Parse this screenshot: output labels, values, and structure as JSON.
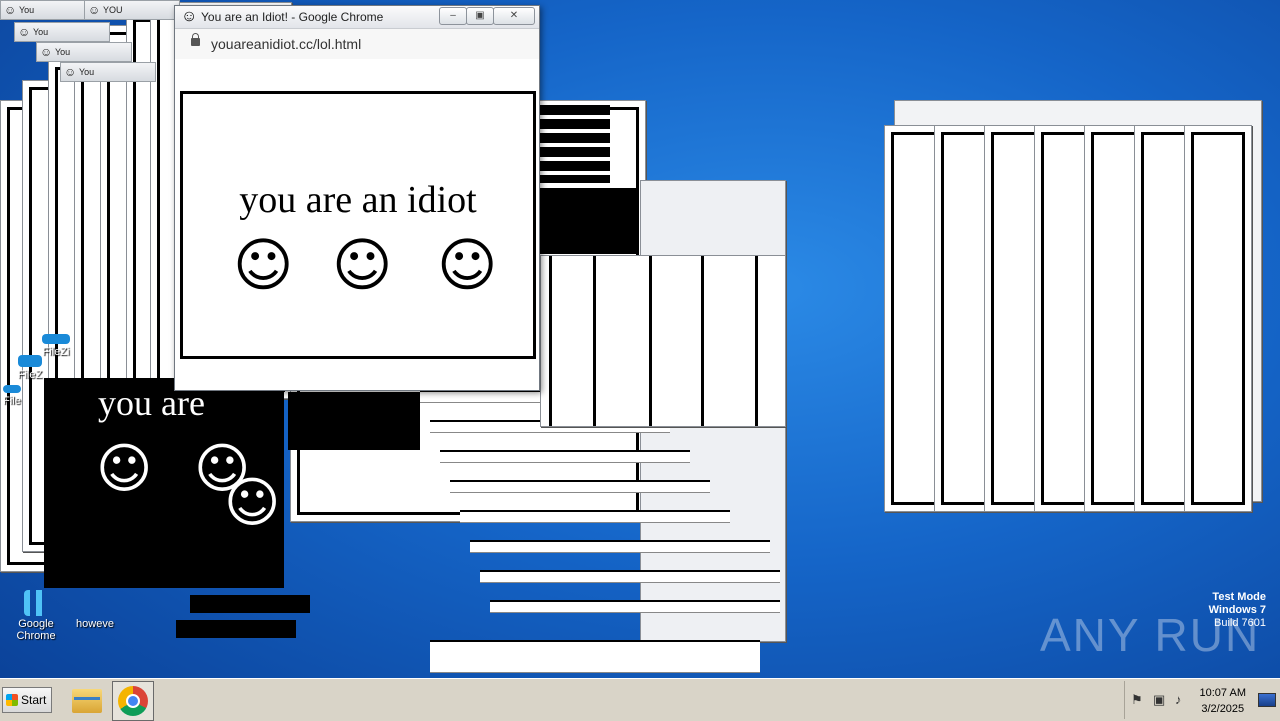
{
  "popup": {
    "window_title": "You are an Idiot! - Google Chrome",
    "url": "youareanidiot.cc/lol.html",
    "headline": "you are an idiot",
    "smiley_glyph": "☺",
    "controls": {
      "minimize": "‒",
      "restore": "▣",
      "close": "✕"
    }
  },
  "dark_copy": {
    "headline": "you are",
    "smiley_glyph": "☺"
  },
  "clutter": {
    "mini_titles": [
      "You",
      "You",
      "You",
      "You",
      "YOU"
    ]
  },
  "desktop_icons": [
    {
      "name": "FileZi",
      "icon": "filezilla-icon"
    },
    {
      "name": "FileZ",
      "icon": "filezilla-icon"
    },
    {
      "name": "File",
      "icon": "filezilla-icon"
    },
    {
      "name": "Google Chrome",
      "icon": "chrome-icon"
    },
    {
      "name": "howeve",
      "icon": "document-icon"
    }
  ],
  "taskbar": {
    "start_label": "Start",
    "apps": [
      {
        "name": "Windows Explorer",
        "icon": "folder-icon"
      },
      {
        "name": "Google Chrome",
        "icon": "chrome-icon"
      }
    ],
    "clock_time": "10:07 AM",
    "clock_date": "3/2/2025"
  },
  "watermark": {
    "line1": "Test Mode",
    "line2": "Windows 7",
    "line3": "Build 7601",
    "brand": "ANY RUN"
  },
  "colors": {
    "desktop_blue": "#1565c8",
    "taskbar": "#d9d4c8"
  }
}
